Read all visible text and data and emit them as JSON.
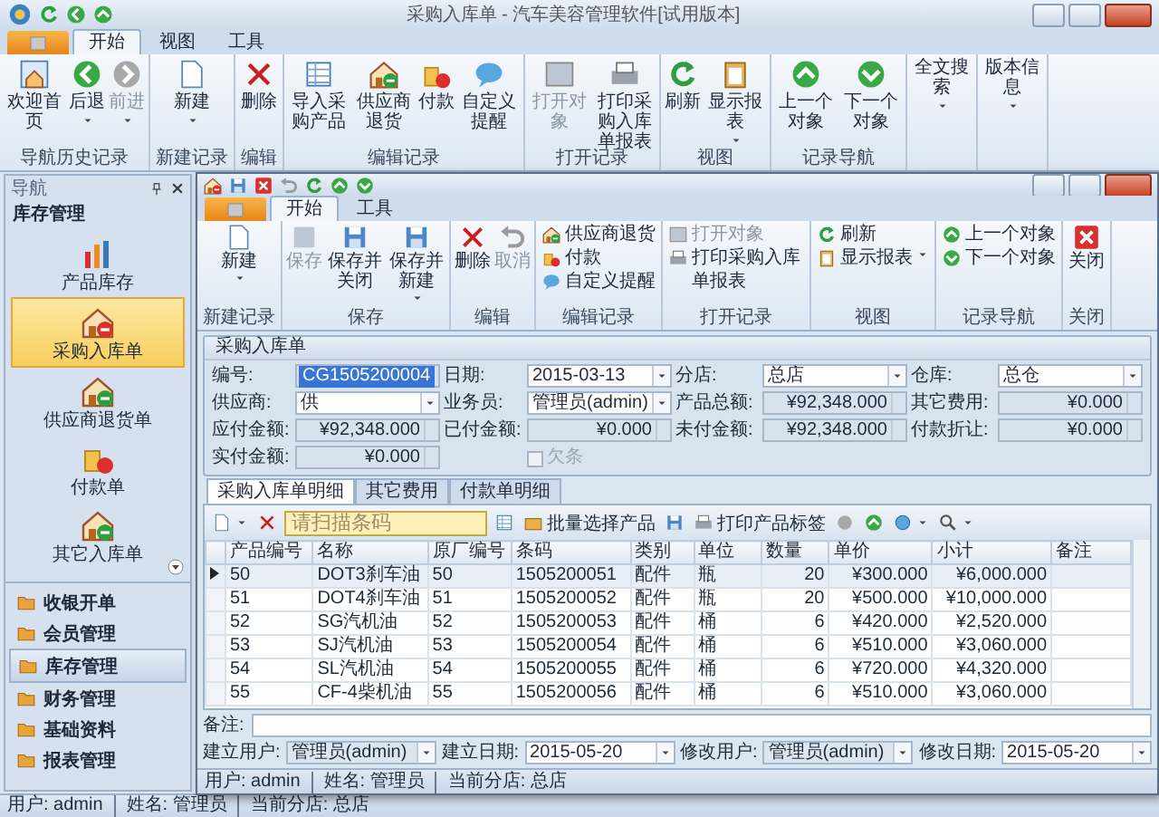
{
  "window": {
    "title": "采购入库单 - 汽车美容管理软件[试用版本]"
  },
  "ribbon": {
    "tabs": [
      {
        "label": "开始",
        "selected": true
      },
      {
        "label": "视图",
        "selected": false
      },
      {
        "label": "工具",
        "selected": false
      }
    ],
    "groups": [
      {
        "label": "导航历史记录",
        "buttons": [
          {
            "label": "欢迎首页",
            "disabled": false,
            "dropdown": false
          },
          {
            "label": "后退",
            "disabled": false,
            "dropdown": true
          },
          {
            "label": "前进",
            "disabled": true,
            "dropdown": true
          }
        ]
      },
      {
        "label": "新建记录",
        "buttons": [
          {
            "label": "新建",
            "disabled": false,
            "dropdown": true
          }
        ]
      },
      {
        "label": "编辑",
        "buttons": [
          {
            "label": "删除",
            "disabled": false,
            "dropdown": false
          }
        ]
      },
      {
        "label": "编辑记录",
        "buttons": [
          {
            "label": "导入采购产品",
            "disabled": false,
            "dropdown": false
          },
          {
            "label": "供应商退货",
            "disabled": false,
            "dropdown": false
          },
          {
            "label": "付款",
            "disabled": false,
            "dropdown": false
          },
          {
            "label": "自定义提醒",
            "disabled": false,
            "dropdown": false
          }
        ]
      },
      {
        "label": "打开记录",
        "buttons": [
          {
            "label": "打开对象",
            "disabled": true,
            "dropdown": false
          },
          {
            "label": "打印采购入库单报表",
            "disabled": false,
            "dropdown": false
          }
        ]
      },
      {
        "label": "视图",
        "buttons": [
          {
            "label": "刷新",
            "disabled": false,
            "dropdown": false
          },
          {
            "label": "显示报表",
            "disabled": false,
            "dropdown": true
          }
        ]
      },
      {
        "label": "记录导航",
        "buttons": [
          {
            "label": "上一个对象",
            "disabled": false,
            "dropdown": false
          },
          {
            "label": "下一个对象",
            "disabled": false,
            "dropdown": false
          }
        ]
      },
      {
        "buttons": [
          {
            "label": "全文搜索",
            "disabled": false,
            "dropdown": true
          }
        ]
      },
      {
        "buttons": [
          {
            "label": "版本信息",
            "disabled": false,
            "dropdown": true
          }
        ]
      }
    ]
  },
  "sidebar": {
    "title": "导航",
    "section": "库存管理",
    "items": [
      {
        "label": "产品库存",
        "selected": false
      },
      {
        "label": "采购入库单",
        "selected": true
      },
      {
        "label": "供应商退货单",
        "selected": false
      },
      {
        "label": "付款单",
        "selected": false
      },
      {
        "label": "其它入库单",
        "selected": false
      }
    ],
    "groups": [
      {
        "label": "收银开单",
        "selected": false
      },
      {
        "label": "会员管理",
        "selected": false
      },
      {
        "label": "库存管理",
        "selected": true
      },
      {
        "label": "财务管理",
        "selected": false
      },
      {
        "label": "基础资料",
        "selected": false
      },
      {
        "label": "报表管理",
        "selected": false
      }
    ]
  },
  "status_bar": [
    "用户: admin",
    "姓名: 管理员",
    "当前分店: 总店"
  ],
  "dialog": {
    "ribbon": {
      "tabs": [
        {
          "label": "开始",
          "selected": true
        },
        {
          "label": "工具",
          "selected": false
        }
      ],
      "groups": [
        {
          "label": "新建记录",
          "buttons": [
            {
              "label": "新建",
              "kind": "large",
              "disabled": false,
              "dropdown": true
            }
          ]
        },
        {
          "label": "保存",
          "buttons": [
            {
              "label": "保存",
              "kind": "large",
              "disabled": true,
              "dropdown": false
            },
            {
              "label": "保存并关闭",
              "kind": "large",
              "disabled": false,
              "dropdown": false
            },
            {
              "label": "保存并新建",
              "kind": "large",
              "disabled": false,
              "dropdown": true
            }
          ]
        },
        {
          "label": "编辑",
          "buttons": [
            {
              "label": "删除",
              "kind": "large",
              "disabled": false,
              "dropdown": false
            },
            {
              "label": "取消",
              "kind": "large",
              "disabled": true,
              "dropdown": false
            }
          ]
        },
        {
          "label": "编辑记录",
          "buttons": [
            {
              "label": "供应商退货",
              "kind": "small",
              "disabled": false,
              "dropdown": false
            },
            {
              "label": "付款",
              "kind": "small",
              "disabled": false,
              "dropdown": false
            },
            {
              "label": "自定义提醒",
              "kind": "small",
              "disabled": false,
              "dropdown": false
            }
          ]
        },
        {
          "label": "打开记录",
          "buttons": [
            {
              "label": "打开对象",
              "kind": "small",
              "disabled": true,
              "dropdown": false
            },
            {
              "label": "打印采购入库单报表",
              "kind": "small",
              "disabled": false,
              "dropdown": false
            }
          ]
        },
        {
          "label": "视图",
          "buttons": [
            {
              "label": "刷新",
              "kind": "small",
              "disabled": false,
              "dropdown": false
            },
            {
              "label": "显示报表",
              "kind": "small",
              "disabled": false,
              "dropdown": true
            }
          ]
        },
        {
          "label": "记录导航",
          "buttons": [
            {
              "label": "上一个对象",
              "kind": "small",
              "disabled": false,
              "dropdown": false
            },
            {
              "label": "下一个对象",
              "kind": "small",
              "disabled": false,
              "dropdown": false
            }
          ]
        },
        {
          "label": "关闭",
          "buttons": [
            {
              "label": "关闭",
              "kind": "large",
              "disabled": false,
              "dropdown": false
            }
          ]
        }
      ]
    },
    "form": {
      "title": "采购入库单",
      "fields": [
        {
          "label": "编号:",
          "value": "CG1505200004",
          "kind": "id"
        },
        {
          "label": "日期:",
          "value": "2015-03-13",
          "kind": "combo"
        },
        {
          "label": "分店:",
          "value": "总店",
          "kind": "combo"
        },
        {
          "label": "仓库:",
          "value": "总仓",
          "kind": "combo"
        },
        {
          "label": "供应商:",
          "value": "供",
          "kind": "combo"
        },
        {
          "label": "业务员:",
          "value": "管理员(admin)",
          "kind": "combo"
        },
        {
          "label": "产品总额:",
          "value": "¥92,348.000",
          "kind": "spin"
        },
        {
          "label": "其它费用:",
          "value": "¥0.000",
          "kind": "spin"
        },
        {
          "label": "应付金额:",
          "value": "¥92,348.000",
          "kind": "spin"
        },
        {
          "label": "已付金额:",
          "value": "¥0.000",
          "kind": "spin"
        },
        {
          "label": "未付金额:",
          "value": "¥92,348.000",
          "kind": "spin"
        },
        {
          "label": "付款折让:",
          "value": "¥0.000",
          "kind": "spin"
        },
        {
          "label": "实付金额:",
          "value": "¥0.000",
          "kind": "spin"
        }
      ],
      "checkbox": {
        "label": "欠条",
        "checked": false,
        "disabled": true
      }
    },
    "detail_tabs": [
      {
        "label": "采购入库单明细",
        "selected": true
      },
      {
        "label": "其它费用",
        "selected": false
      },
      {
        "label": "付款单明细",
        "selected": false
      }
    ],
    "detail_toolbar": {
      "barcode": {
        "placeholder": "请扫描条码"
      },
      "buttons": [
        {
          "label": "批量选择产品"
        },
        {
          "label": "打印产品标签"
        }
      ]
    },
    "table": {
      "columns": [
        "产品编号",
        "名称",
        "原厂编号",
        "条码",
        "类别",
        "单位",
        "数量",
        "单价",
        "小计",
        "备注"
      ],
      "rows": [
        {
          "selected": true,
          "cells": [
            "50",
            "DOT3刹车油",
            "50",
            "1505200051",
            "配件",
            "瓶",
            "20",
            "¥300.000",
            "¥6,000.000"
          ]
        },
        {
          "selected": false,
          "cells": [
            "51",
            "DOT4刹车油",
            "51",
            "1505200052",
            "配件",
            "瓶",
            "20",
            "¥500.000",
            "¥10,000.000"
          ]
        },
        {
          "selected": false,
          "cells": [
            "52",
            "SG汽机油",
            "52",
            "1505200053",
            "配件",
            "桶",
            "6",
            "¥420.000",
            "¥2,520.000"
          ]
        },
        {
          "selected": false,
          "cells": [
            "53",
            "SJ汽机油",
            "53",
            "1505200054",
            "配件",
            "桶",
            "6",
            "¥510.000",
            "¥3,060.000"
          ]
        },
        {
          "selected": false,
          "cells": [
            "54",
            "SL汽机油",
            "54",
            "1505200055",
            "配件",
            "桶",
            "6",
            "¥720.000",
            "¥4,320.000"
          ]
        },
        {
          "selected": false,
          "cells": [
            "55",
            "CF-4柴机油",
            "55",
            "1505200056",
            "配件",
            "桶",
            "6",
            "¥510.000",
            "¥3,060.000"
          ]
        }
      ]
    },
    "remarks": {
      "label": "备注:"
    },
    "meta": [
      {
        "label": "建立用户:",
        "value": "管理员(admin)",
        "disabled": true
      },
      {
        "label": "建立日期:",
        "value": "2015-05-20",
        "disabled": false
      },
      {
        "label": "修改用户:",
        "value": "管理员(admin)",
        "disabled": true
      },
      {
        "label": "修改日期:",
        "value": "2015-05-20",
        "disabled": false
      }
    ],
    "status_bar": [
      "用户: admin",
      "姓名: 管理员",
      "当前分店: 总店"
    ]
  }
}
